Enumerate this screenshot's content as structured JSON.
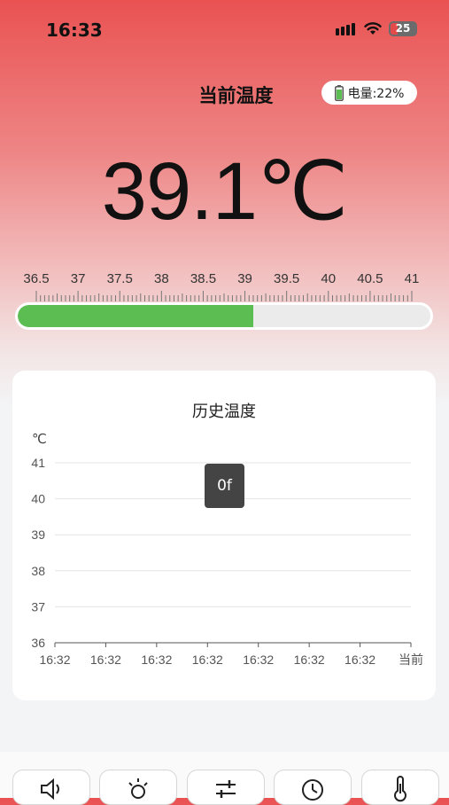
{
  "status_bar": {
    "time": "16:33",
    "battery_level": "25"
  },
  "header": {
    "title": "当前温度",
    "battery_label": "电量:22%"
  },
  "current": {
    "temperature": "39.1℃"
  },
  "scale": {
    "labels": [
      "36.5",
      "37",
      "37.5",
      "38",
      "38.5",
      "39",
      "39.5",
      "40",
      "40.5",
      "41"
    ],
    "min": 36.5,
    "max": 41,
    "value": 39.1,
    "fill_color": "#5cbd52"
  },
  "history": {
    "title": "历史温度",
    "tooltip": "0f"
  },
  "chart_data": {
    "type": "line",
    "title": "历史温度",
    "ylabel": "℃",
    "ylim": [
      36,
      41
    ],
    "yticks": [
      "41",
      "40",
      "39",
      "38",
      "37",
      "36"
    ],
    "categories": [
      "16:32",
      "16:32",
      "16:32",
      "16:32",
      "16:32",
      "16:32",
      "16:32",
      "当前"
    ],
    "series": [],
    "grid": true
  },
  "tabbar": {
    "icons": [
      "speaker-icon",
      "light-icon",
      "sliders-icon",
      "clock-icon",
      "thermometer-icon"
    ]
  },
  "colors": {
    "accent": "#ea5252",
    "progress": "#5cbd52",
    "tooltip": "#444444"
  }
}
